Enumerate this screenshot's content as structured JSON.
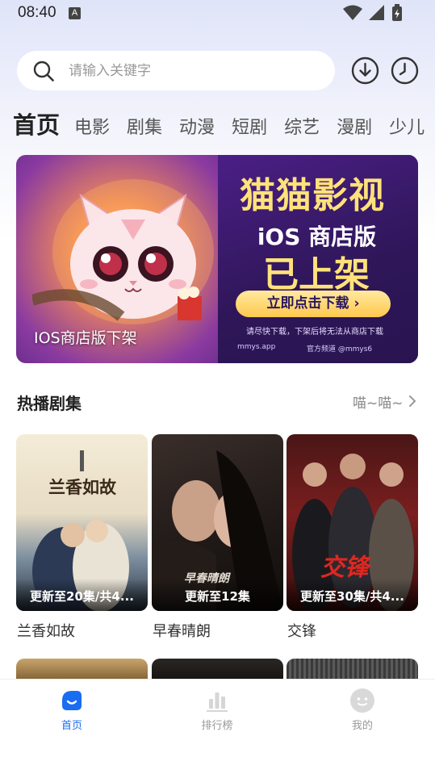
{
  "status_bar": {
    "time": "08:40",
    "badge": "A"
  },
  "search": {
    "placeholder": "请输入关键字"
  },
  "tabs": [
    {
      "label": "首页",
      "active": true
    },
    {
      "label": "电影"
    },
    {
      "label": "剧集"
    },
    {
      "label": "动漫"
    },
    {
      "label": "短剧"
    },
    {
      "label": "综艺"
    },
    {
      "label": "漫剧"
    },
    {
      "label": "少儿"
    }
  ],
  "banner": {
    "title": "猫猫影视",
    "subtitle1": "iOS 商店版",
    "subtitle2": "已上架",
    "button": "立即点击下载 ›",
    "note": "请尽快下载，下架后将无法从商店下载",
    "site": "mmys.app",
    "channel": "官方频道 @mmys6",
    "caption": "IOS商店版下架"
  },
  "section": {
    "title": "热播剧集",
    "more": "喵~喵~"
  },
  "cards": [
    {
      "title": "兰香如故",
      "status": "更新至20集/共4...",
      "poster_text": "兰香如故"
    },
    {
      "title": "早春晴朗",
      "status": "更新至12集",
      "poster_text": "早春晴朗"
    },
    {
      "title": "交锋",
      "status": "更新至30集/共4...",
      "poster_text": "交锋"
    }
  ],
  "nav": [
    {
      "label": "首页",
      "icon": "home-icon",
      "active": true
    },
    {
      "label": "排行榜",
      "icon": "ranking-icon"
    },
    {
      "label": "我的",
      "icon": "profile-icon"
    }
  ],
  "colors": {
    "accent": "#1a6cf2",
    "banner_gold": "#ffe27a"
  }
}
